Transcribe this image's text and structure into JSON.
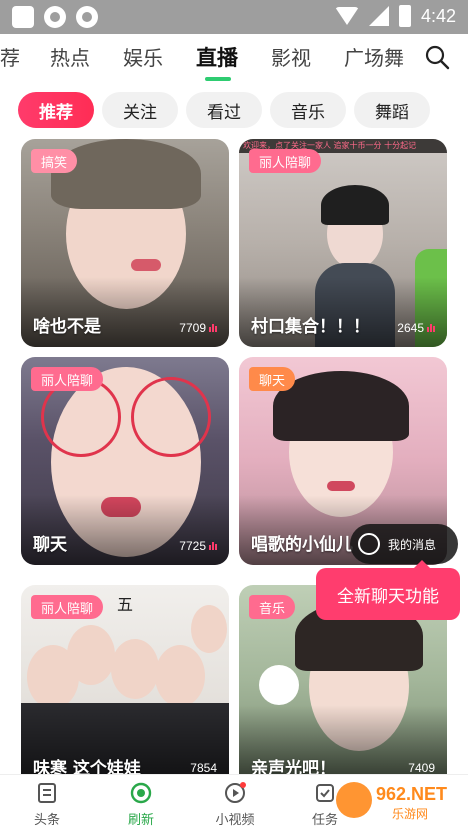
{
  "status_bar": {
    "time": "4:42"
  },
  "top_tabs": {
    "items": [
      {
        "label": "荐",
        "active": false
      },
      {
        "label": "热点",
        "active": false
      },
      {
        "label": "娱乐",
        "active": false
      },
      {
        "label": "直播",
        "active": true
      },
      {
        "label": "影视",
        "active": false
      },
      {
        "label": "广场舞",
        "active": false
      }
    ],
    "search_icon": "search-icon",
    "accent_color": "#2ecc71"
  },
  "chips": [
    {
      "label": "推荐",
      "active": true
    },
    {
      "label": "关注",
      "active": false
    },
    {
      "label": "看过",
      "active": false
    },
    {
      "label": "音乐",
      "active": false
    },
    {
      "label": "舞蹈",
      "active": false
    }
  ],
  "cards": [
    {
      "tag": "搞笑",
      "title": "啥也不是",
      "views": "7709"
    },
    {
      "tag": "丽人陪聊",
      "title": "村口集合！！！",
      "views": "2645",
      "banner_text": "欢迎来，点了关注一家人  追家十币一分  十分起记"
    },
    {
      "tag": "丽人陪聊",
      "title": "聊天",
      "views": "7725"
    },
    {
      "tag": "聊天",
      "title": "唱歌的小仙儿",
      "views": ""
    },
    {
      "tag": "丽人陪聊",
      "title": "味寒 这个娃娃",
      "views": "7854",
      "sign_text": "五"
    },
    {
      "tag": "音乐",
      "title": "亲声光吧！",
      "views": "7409"
    }
  ],
  "message_bubble": {
    "label": "我的消息"
  },
  "new_feature_popup": {
    "label": "全新聊天功能"
  },
  "bottom_nav": [
    {
      "label": "头条",
      "icon": "document-icon",
      "active": false
    },
    {
      "label": "刷新",
      "icon": "refresh-icon",
      "active": true
    },
    {
      "label": "小视频",
      "icon": "play-icon",
      "active": false
    },
    {
      "label": "任务",
      "icon": "task-icon",
      "active": false
    }
  ],
  "watermark": {
    "text": "962.NET",
    "subtext": "乐游网"
  }
}
